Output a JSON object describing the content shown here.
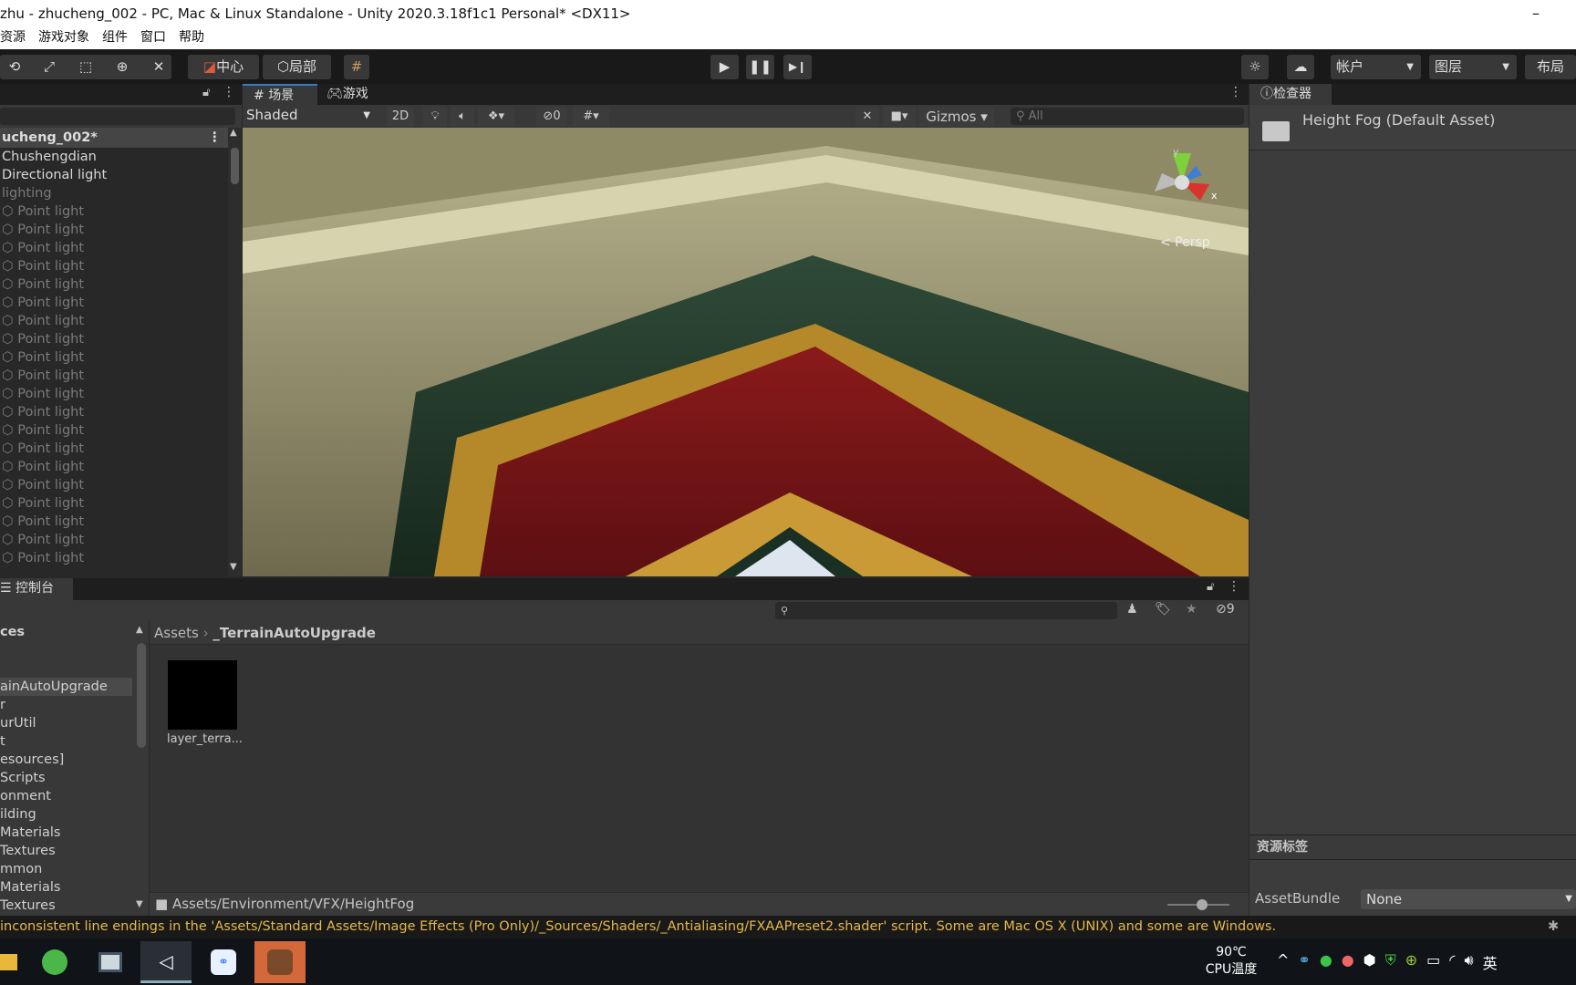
{
  "window": {
    "title": "zhu - zhucheng_002 - PC, Mac & Linux Standalone - Unity 2020.3.18f1c1 Personal* <DX11>",
    "minimize": "–"
  },
  "menu": [
    "资源",
    "游戏对象",
    "组件",
    "窗口",
    "帮助"
  ],
  "toolbar": {
    "pivot": "中心",
    "local": "局部",
    "account": "帐户",
    "layers": "图层",
    "layout": "布局",
    "icons": [
      "rotate-icon",
      "scale-icon",
      "rect-tool-icon",
      "transform-icon",
      "custom-tool-icon",
      "play-icon",
      "pause-icon",
      "step-icon",
      "services-icon",
      "cloud-icon"
    ]
  },
  "hierarchy": {
    "scene": "ucheng_002*",
    "items": [
      {
        "label": "Chushengdian",
        "state": "active"
      },
      {
        "label": "Directional light",
        "state": "active"
      },
      {
        "label": "lighting",
        "state": "inactive"
      },
      {
        "label": "Point light",
        "state": "inactive"
      },
      {
        "label": "Point light",
        "state": "inactive"
      },
      {
        "label": "Point light",
        "state": "inactive"
      },
      {
        "label": "Point light",
        "state": "inactive"
      },
      {
        "label": "Point light",
        "state": "inactive"
      },
      {
        "label": "Point light",
        "state": "inactive"
      },
      {
        "label": "Point light",
        "state": "inactive"
      },
      {
        "label": "Point light",
        "state": "inactive"
      },
      {
        "label": "Point light",
        "state": "inactive"
      },
      {
        "label": "Point light",
        "state": "inactive"
      },
      {
        "label": "Point light",
        "state": "inactive"
      },
      {
        "label": "Point light",
        "state": "inactive"
      },
      {
        "label": "Point light",
        "state": "inactive"
      },
      {
        "label": "Point light",
        "state": "inactive"
      },
      {
        "label": "Point light",
        "state": "inactive"
      },
      {
        "label": "Point light",
        "state": "inactive"
      },
      {
        "label": "Point light",
        "state": "inactive"
      },
      {
        "label": "Point light",
        "state": "inactive"
      },
      {
        "label": "Point light",
        "state": "inactive"
      },
      {
        "label": "Point light",
        "state": "inactive"
      }
    ]
  },
  "scene": {
    "tab_scene": "场景",
    "tab_game": "游戏",
    "shading": "Shaded",
    "mode_2d": "2D",
    "hidden_count": "0",
    "gizmos": "Gizmos",
    "search_placeholder": "All",
    "persp": "< Persp",
    "axis_y": "y",
    "axis_x": "x"
  },
  "inspector": {
    "tab": "检查器",
    "asset_name": "Height Fog (Default Asset)",
    "labels_header": "资源标签",
    "assetbundle_label": "AssetBundle",
    "assetbundle_value": "None"
  },
  "project": {
    "tab": "控制台",
    "hidden_count": "9",
    "tree": [
      {
        "label": "ces",
        "bold": true
      },
      {
        "label": ""
      },
      {
        "label": ""
      },
      {
        "label": "ainAutoUpgrade",
        "selected": true
      },
      {
        "label": "r"
      },
      {
        "label": "urUtil"
      },
      {
        "label": "t"
      },
      {
        "label": "esources]"
      },
      {
        "label": "Scripts"
      },
      {
        "label": "onment"
      },
      {
        "label": "ilding"
      },
      {
        "label": "Materials"
      },
      {
        "label": "Textures"
      },
      {
        "label": "mmon"
      },
      {
        "label": "Materials"
      },
      {
        "label": "Textures"
      }
    ],
    "breadcrumb": [
      "Assets",
      "_TerrainAutoUpgrade"
    ],
    "assets": [
      {
        "label": "layer_terra..."
      }
    ],
    "path": "Assets/Environment/VFX/HeightFog"
  },
  "status": {
    "message": "inconsistent line endings in the 'Assets/Standard Assets/Image Effects (Pro Only)/_Sources/Shaders/_Antialiasing/FXAAPreset2.shader' script. Some are Mac OS X (UNIX) and some are Windows."
  },
  "taskbar": {
    "temp": "90℃",
    "temp_label": "CPU温度",
    "ime": "英"
  }
}
